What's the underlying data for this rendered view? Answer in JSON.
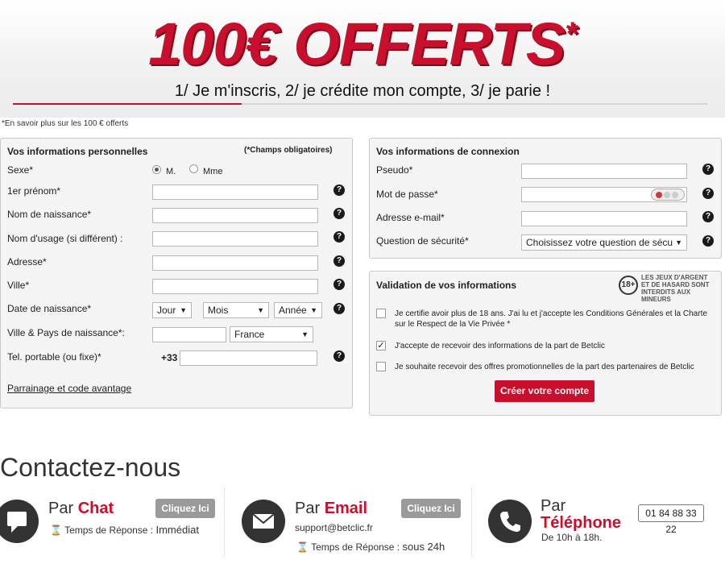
{
  "banner": {
    "title": "100€ OFFERTS",
    "star": "*",
    "subtitle": "1/ Je m'inscris, 2/ je crédite mon compte, 3/ je parie !",
    "progress": 0.33,
    "more_link": "*En savoir plus sur les 100 € offerts"
  },
  "personal": {
    "title": "Vos informations personnelles",
    "required_note": "(*Champs obligatoires)",
    "sexe_label": "Sexe*",
    "sexe_m": "M.",
    "sexe_mme": "Mme",
    "prenom_label": "1er prénom*",
    "nom_naissance_label": "Nom de naissance*",
    "nom_usage_label": "Nom d'usage (si différent) :",
    "adresse_label": "Adresse*",
    "ville_label": "Ville*",
    "date_label": "Date de naissance*",
    "jour": "Jour",
    "mois": "Mois",
    "annee": "Année",
    "lieu_label": "Ville & Pays de naissance*:",
    "pays": "France",
    "tel_label": "Tel. portable (ou fixe)*",
    "tel_prefix": "+33",
    "parrainage": "Parrainage et code avantage"
  },
  "connexion": {
    "title": "Vos informations de connexion",
    "pseudo_label": "Pseudo*",
    "password_label": "Mot de passe*",
    "email_label": "Adresse e-mail*",
    "question_label": "Question de sécurité*",
    "question_value": "Choisissez votre question de sécur"
  },
  "validation": {
    "title": "Validation de vos informations",
    "age_badge": "18+",
    "age_text_1": "LES JEUX D'ARGENT",
    "age_text_2": "ET DE HASARD SONT",
    "age_text_3": "INTERDITS AUX MINEURS",
    "check1_line1": "Je certifie avoir plus de 18 ans. J'ai lu et j'accepte les Conditions Générales et la Charte",
    "check1_line2": "sur le Respect de la Vie Privée *",
    "check2": "J'accepte de recevoir des informations de la part de Betclic",
    "check3": "Je souhaite recevoir des offres promotionnelles de la part des partenaires de Betclic",
    "submit": "Créer votre compte"
  },
  "contact": {
    "title": "Contactez-nous",
    "chat_prefix": "Par ",
    "chat_channel": "Chat",
    "chat_button": "Cliquez Ici",
    "chat_time_label": "Temps de Réponse : ",
    "chat_time_value": "Immédiat",
    "email_prefix": "Par ",
    "email_channel": "Email",
    "email_button": "Cliquez Ici",
    "email_address": "support@betclic.fr",
    "email_time_label": "Temps de Réponse : ",
    "email_time_value": "sous 24h",
    "phone_prefix": "Par",
    "phone_channel": "Téléphone",
    "phone_hours": "De 10h à 18h.",
    "phone_number": "01 84 88 33 22"
  },
  "colors": {
    "brand_red": "#c8102e",
    "panel_bg": "#f4f4f4",
    "dark_icon": "#333333"
  }
}
